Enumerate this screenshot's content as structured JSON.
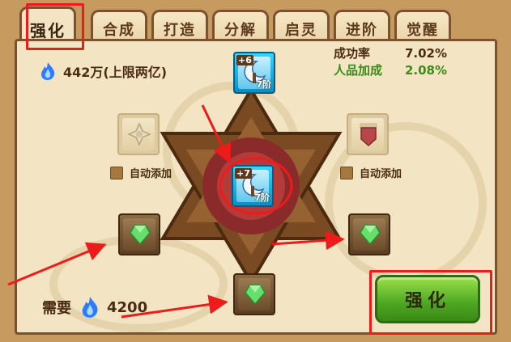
{
  "tabs": [
    {
      "label": "强化"
    },
    {
      "label": "合成"
    },
    {
      "label": "打造"
    },
    {
      "label": "分解"
    },
    {
      "label": "启灵"
    },
    {
      "label": "进阶"
    },
    {
      "label": "觉醒"
    }
  ],
  "currency": {
    "amount_text": "442万(上限两亿)",
    "icon": "blue-flame-icon"
  },
  "stats": {
    "success_label": "成功率",
    "success_value": "7.02%",
    "luck_label": "人品加成",
    "luck_value": "2.08%"
  },
  "slots": {
    "top": {
      "level": "+6",
      "grade": "7阶"
    },
    "center": {
      "level": "+7",
      "grade": "7阶"
    }
  },
  "auto_add": {
    "left_label": "自动添加",
    "right_label": "自动添加"
  },
  "cost": {
    "label": "需要",
    "value": "4200"
  },
  "action": {
    "label": "强化"
  },
  "colors": {
    "highlight": "#ee1b1b",
    "accent_green": "#3a8a19",
    "button_green": "#4ca721"
  }
}
